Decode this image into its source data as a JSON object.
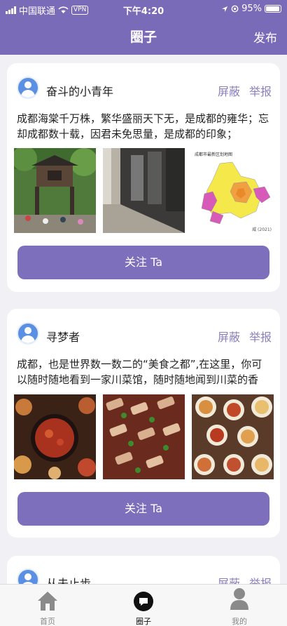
{
  "status_bar": {
    "carrier": "中国联通",
    "vpn": "VPN",
    "time": "下午4:20",
    "battery": "95%"
  },
  "header": {
    "title": "圈子",
    "publish_label": "发布"
  },
  "posts": [
    {
      "username": "奋斗的小青年",
      "block_label": "屏蔽",
      "report_label": "举报",
      "text": "成都海棠千万株，繁华盛丽天下无，是成都的雍华；忘却成都数十载，因君未免思量，是成都的印象；",
      "follow_label": "关注 Ta",
      "images": [
        "ancient-chengdu-street",
        "modern-alley-shops",
        "chengdu-district-map"
      ],
      "map_title": "成都市最新区划地图",
      "map_caption": "威 (2021)"
    },
    {
      "username": "寻梦者",
      "block_label": "屏蔽",
      "report_label": "举报",
      "text": "成都，也是世界数一数二的“美食之都”,在这里，你可以随时随地看到一家川菜馆，随时随地闻到川菜的香味，与品尝到正…",
      "follow_label": "关注 Ta",
      "images": [
        "hotpot-table",
        "sichuan-skewers",
        "small-dishes-spread"
      ]
    },
    {
      "username": "从未止步",
      "block_label": "屏蔽",
      "report_label": "举报"
    }
  ],
  "tabbar": {
    "home_label": "首页",
    "circle_label": "圈子",
    "mine_label": "我的"
  },
  "colors": {
    "brand": "#7a6bb8",
    "button": "#7d6fbc",
    "action_text": "#8a80bd",
    "avatar": "#5b8fe4"
  }
}
